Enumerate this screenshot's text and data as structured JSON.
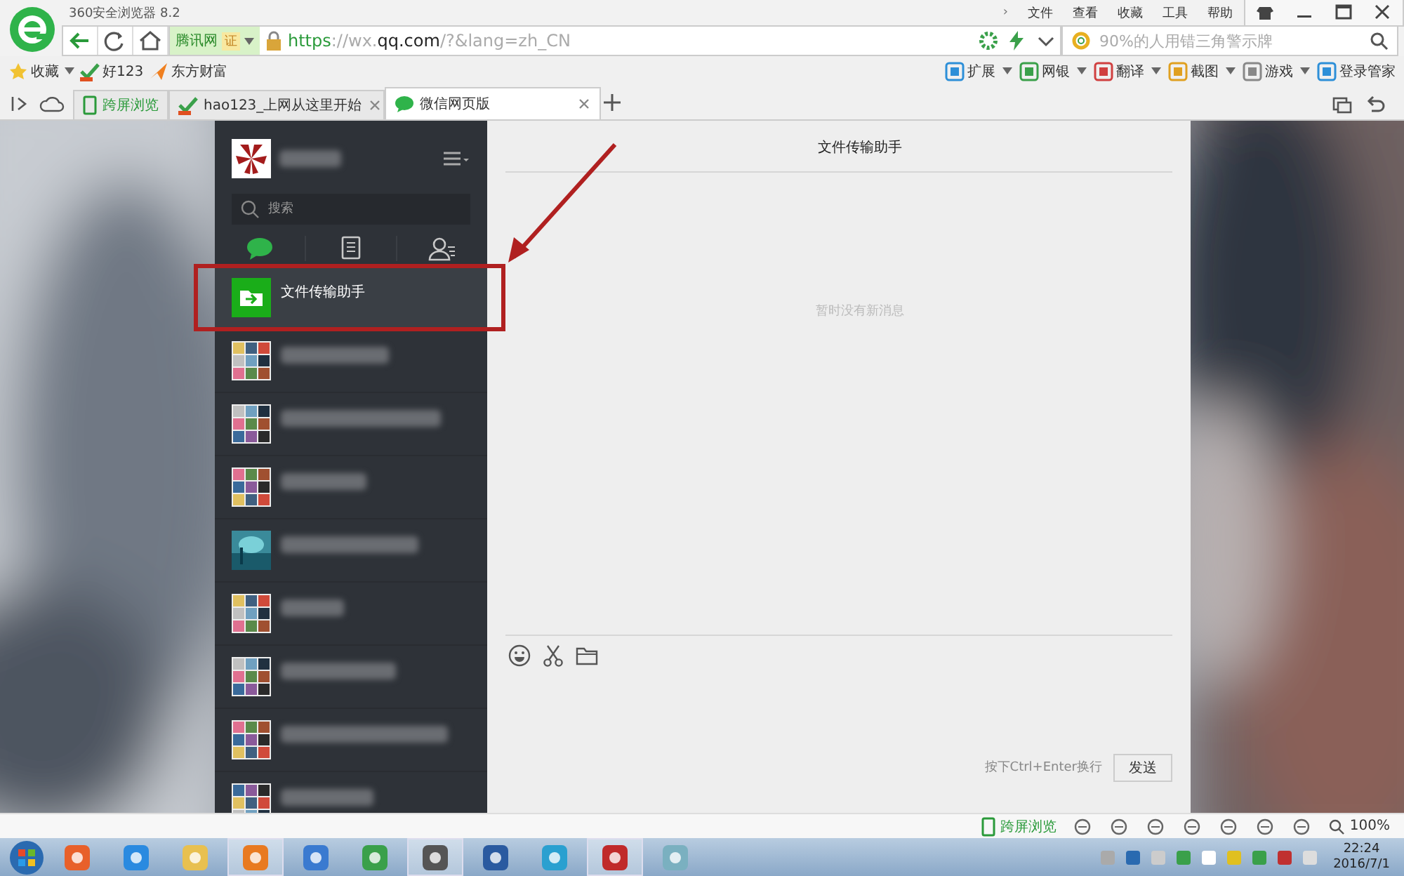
{
  "browser": {
    "title": "360安全浏览器 8.2",
    "menu_chevron": "›",
    "menu": [
      "文件",
      "查看",
      "收藏",
      "工具",
      "帮助"
    ],
    "site_badge": "腾讯网",
    "cert_badge": "证",
    "url_scheme": "https",
    "url_rest": "://wx.",
    "url_domain": "qq.com",
    "url_path": "/?&lang=zh_CN",
    "search_placeholder": "90%的人用错三角警示牌",
    "bookmarks": [
      {
        "label": "收藏",
        "kind": "star"
      },
      {
        "label": "好123",
        "kind": "hao"
      },
      {
        "label": "东方财富",
        "kind": "bird"
      }
    ],
    "tools": [
      "扩展",
      "网银",
      "翻译",
      "截图",
      "游戏",
      "登录管家"
    ],
    "cross_screen": "跨屏浏览",
    "tabs": [
      {
        "label": "hao123_上网从这里开始",
        "selected": false
      },
      {
        "label": "微信网页版",
        "selected": true
      }
    ]
  },
  "wechat": {
    "search_placeholder": "搜索",
    "nav": [
      {
        "kind": "chat",
        "selected": true
      },
      {
        "kind": "article",
        "selected": false
      },
      {
        "kind": "contacts",
        "selected": false
      }
    ],
    "chats": [
      {
        "name": "文件传输助手",
        "selected": true,
        "kind": "file"
      },
      {
        "selected": false,
        "kind": "blurred"
      },
      {
        "selected": false,
        "kind": "blurred"
      },
      {
        "selected": false,
        "kind": "blurred"
      },
      {
        "selected": false,
        "kind": "blurred"
      },
      {
        "selected": false,
        "kind": "blurred"
      },
      {
        "selected": false,
        "kind": "blurred"
      },
      {
        "selected": false,
        "kind": "blurred"
      },
      {
        "selected": false,
        "kind": "blurred"
      }
    ],
    "chat_title": "文件传输助手",
    "empty_message": "暂时没有新消息",
    "input_hint": "按下Ctrl+Enter换行",
    "send_button": "发送"
  },
  "status_bar": {
    "cross_screen": "跨屏浏览",
    "zoom": "100%"
  },
  "taskbar": {
    "time": "22:24",
    "date": "2016/7/1"
  }
}
